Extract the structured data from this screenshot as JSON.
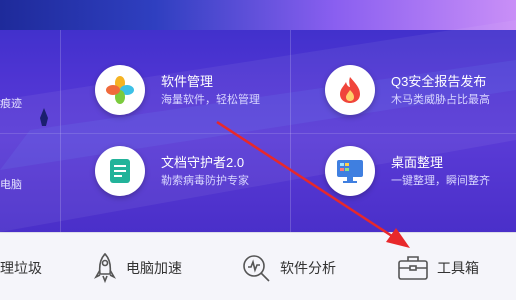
{
  "features": [
    {
      "title": "软件管理",
      "subtitle": "海量软件，轻松管理",
      "icon": "pinwheel-icon"
    },
    {
      "title": "Q3安全报告发布",
      "subtitle": "木马类威胁占比最高",
      "icon": "flame-icon"
    },
    {
      "title": "文档守护者2.0",
      "subtitle": "勒索病毒防护专家",
      "icon": "document-icon"
    },
    {
      "title": "桌面整理",
      "subtitle": "一键整理，瞬间整齐",
      "icon": "monitor-icon"
    }
  ],
  "edge_texts": [
    "痕迹",
    "电脑"
  ],
  "toolbar": [
    {
      "label": "理垃圾",
      "icon": "trash-icon"
    },
    {
      "label": "电脑加速",
      "icon": "rocket-icon"
    },
    {
      "label": "软件分析",
      "icon": "magnifier-chart-icon"
    },
    {
      "label": "工具箱",
      "icon": "toolbox-icon"
    }
  ],
  "colors": {
    "banner": "#4f35d3",
    "arrow": "#e8282b",
    "toolbar_bg": "#f5f5fa"
  }
}
